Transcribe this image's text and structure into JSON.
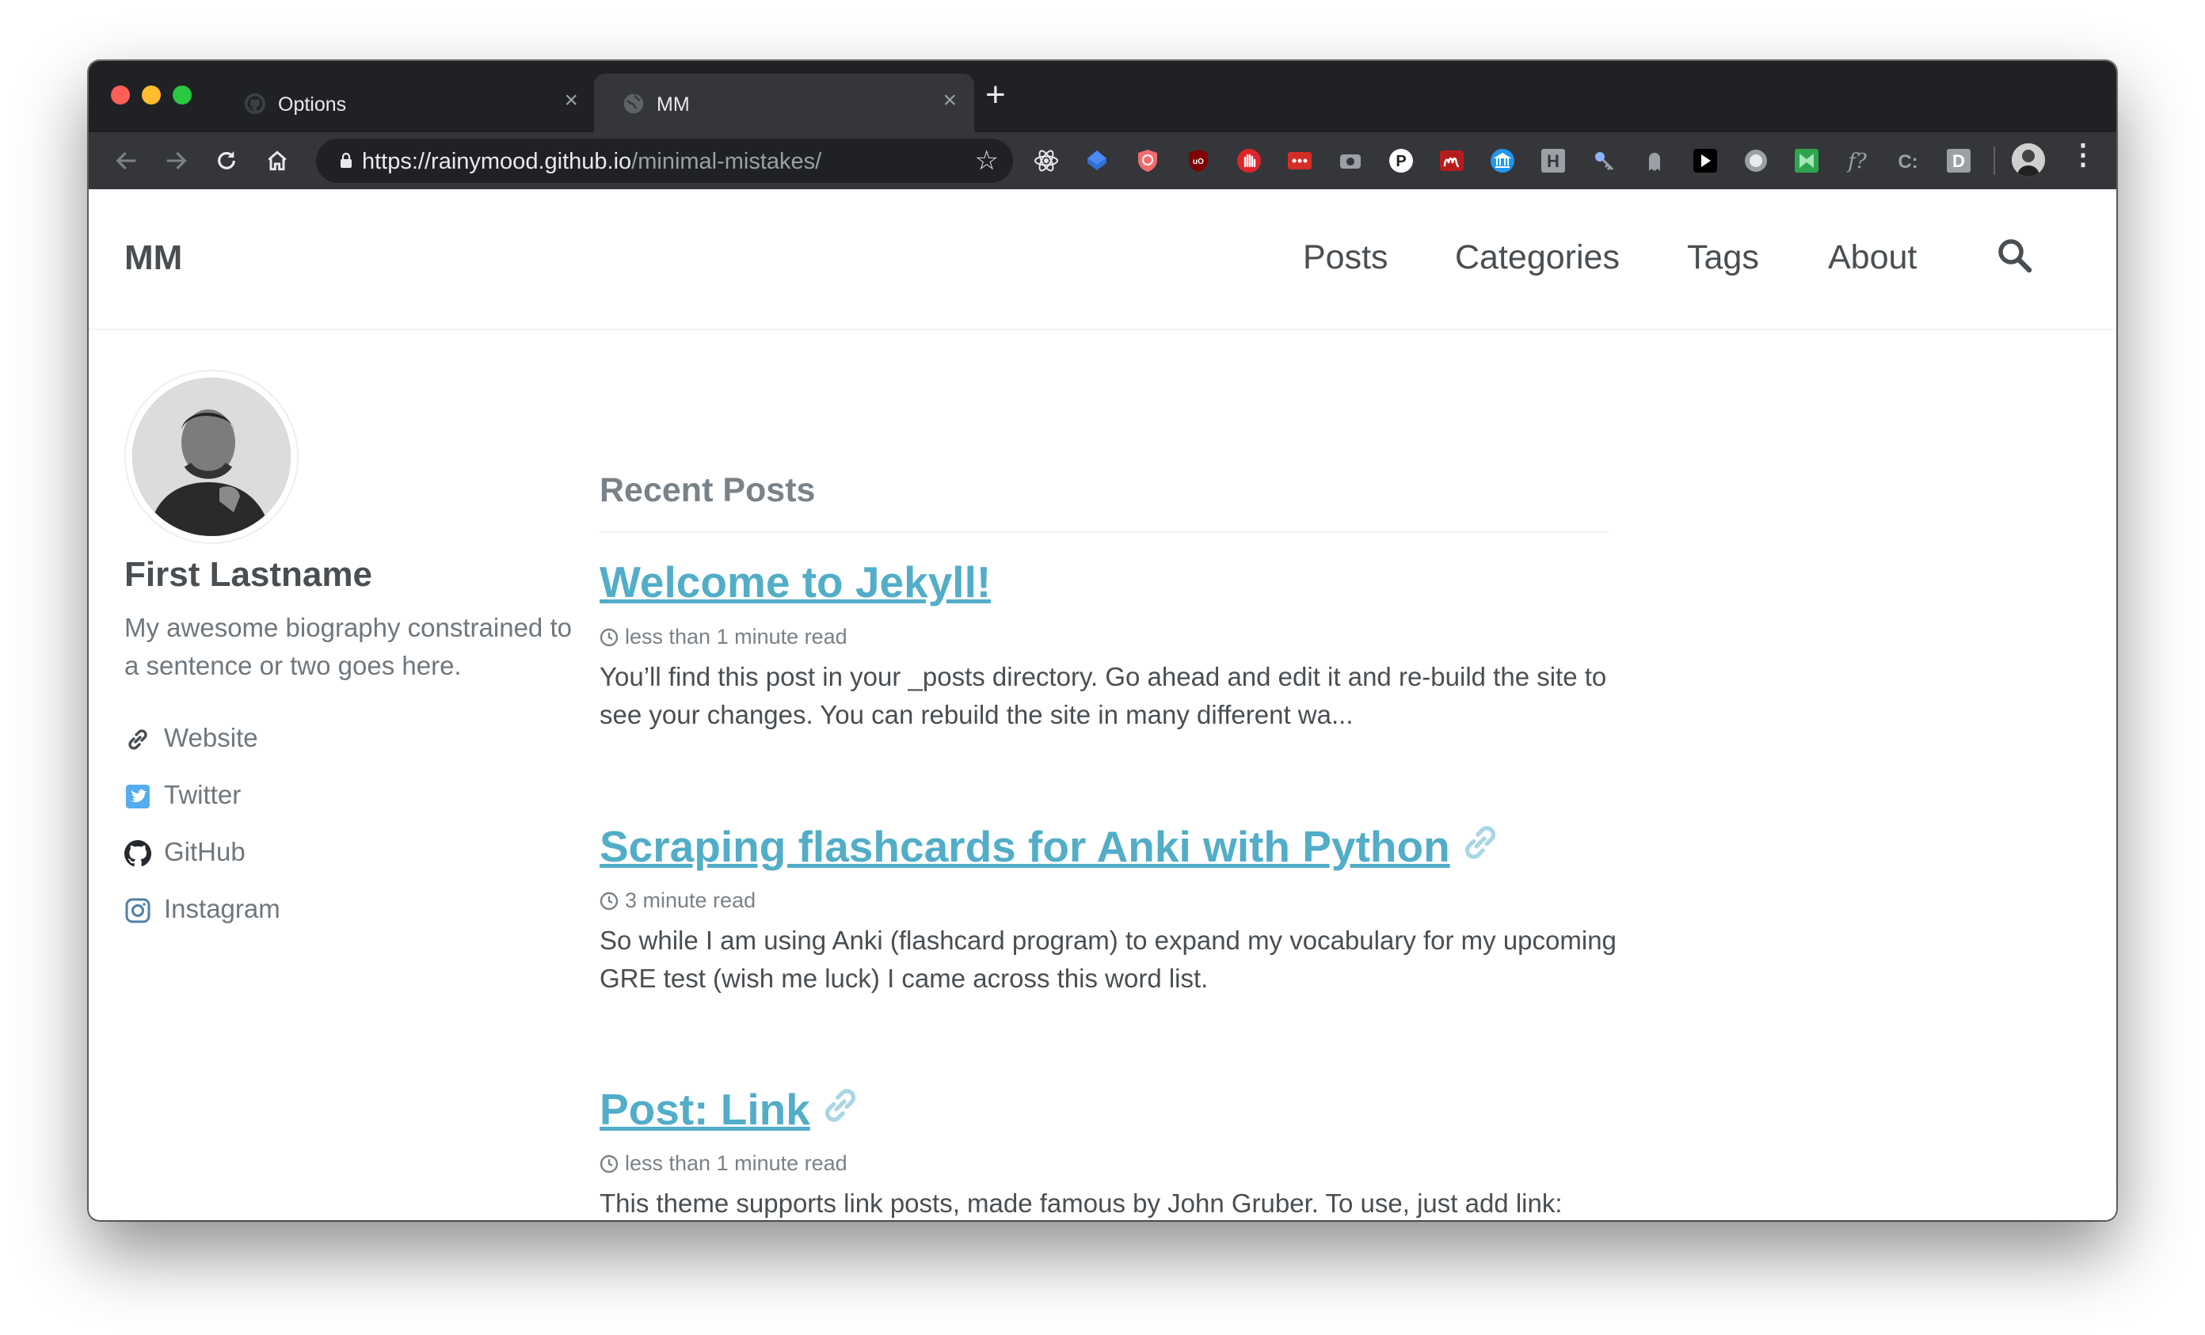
{
  "browser": {
    "tabs": [
      {
        "title": "Options",
        "favicon": "github-icon",
        "active": false
      },
      {
        "title": "MM",
        "favicon": "globe-icon",
        "active": true
      }
    ],
    "new_tab_label": "+",
    "close_label": "×",
    "url_host": "https://rainymood.github.io",
    "url_path": "/minimal-mistakes/",
    "extensions": [
      "react-devtools-icon",
      "blue-badge-icon",
      "shield-icon",
      "ublock-icon",
      "stop-hand-icon",
      "lastpass-icon",
      "camera-icon",
      "pinboard-icon",
      "mendeley-icon",
      "library-icon",
      "h-icon",
      "key-icon",
      "ghost-icon",
      "play-icon",
      "circle-icon",
      "bookmark-icon",
      "formula-icon",
      "code-icon",
      "d-icon"
    ]
  },
  "site": {
    "brand": "MM",
    "nav": [
      "Posts",
      "Categories",
      "Tags",
      "About"
    ]
  },
  "author": {
    "name": "First Lastname",
    "bio": "My awesome biography constrained to a sentence or two goes here.",
    "links": [
      {
        "label": "Website",
        "icon": "link-icon"
      },
      {
        "label": "Twitter",
        "icon": "twitter-icon"
      },
      {
        "label": "GitHub",
        "icon": "github-icon"
      },
      {
        "label": "Instagram",
        "icon": "instagram-icon"
      }
    ]
  },
  "main": {
    "heading": "Recent Posts",
    "posts": [
      {
        "title": "Welcome to Jekyll!",
        "read_time": "less than 1 minute read",
        "excerpt": "You’ll find this post in your _posts directory. Go ahead and edit it and re-build the site to see your changes. You can rebuild the site in many different wa...",
        "link_post": false
      },
      {
        "title": "Scraping flashcards for Anki with Python",
        "read_time": "3 minute read",
        "excerpt": "So while I am using Anki (flashcard program) to expand my vocabulary for my upcoming GRE test (wish me luck) I came across this word list.",
        "link_post": true
      },
      {
        "title": "Post: Link",
        "read_time": "less than 1 minute read",
        "excerpt": "This theme supports link posts, made famous by John Gruber. To use, just add link: http://url-you-want-linked to the post’s YAML front matter and you’re done.",
        "link_post": true
      }
    ]
  },
  "colors": {
    "link": "#52adc8",
    "text": "#494e52",
    "muted": "#7a8288",
    "chrome_dark": "#202124",
    "chrome_toolbar": "#35363a"
  }
}
